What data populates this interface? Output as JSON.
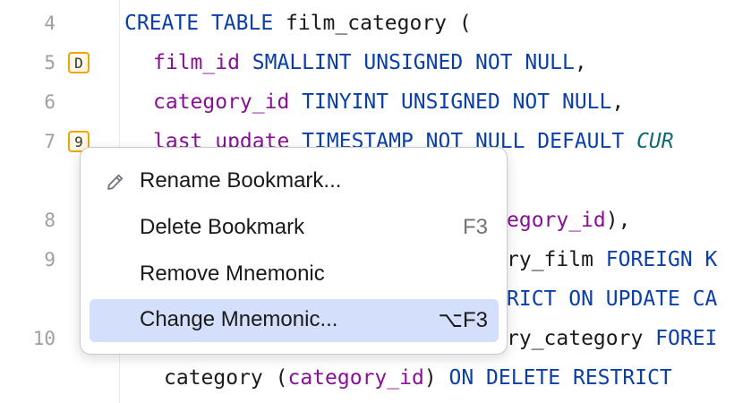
{
  "editor": {
    "line_numbers": [
      "4",
      "5",
      "6",
      "7",
      "8",
      "9",
      "10"
    ],
    "bookmarks": [
      {
        "line": "5",
        "mnemonic": "D"
      },
      {
        "line": "7",
        "mnemonic": "9"
      }
    ],
    "code": {
      "l1": {
        "kw1": "CREATE TABLE",
        "name": " film_category ("
      },
      "l2": {
        "id": "film_id",
        "type": " SMALLINT UNSIGNED NOT NULL",
        "punct": ","
      },
      "l3": {
        "id": "category_id",
        "type": " TINYINT UNSIGNED NOT NULL",
        "punct": ","
      },
      "l4": {
        "id": "last_update",
        "type": " TIMESTAMP NOT NULL DEFAULT ",
        "fn": "CUR"
      },
      "l5": {
        "id": "egory_id",
        "punct": "),"
      },
      "l6": {
        "plain": "ry_film ",
        "kw": "FOREIGN K"
      },
      "l7": {
        "kw": "RICT ON UPDATE CA"
      },
      "l8": {
        "plain": "ry_category ",
        "kw": "FOREI"
      },
      "l9": {
        "plain": "category (",
        "id": "category_id",
        "punct": ") ",
        "kw": "ON DELETE RESTRICT"
      }
    }
  },
  "context_menu": {
    "items": [
      {
        "label": "Rename Bookmark...",
        "shortcut": "",
        "icon": "pencil-icon"
      },
      {
        "label": "Delete Bookmark",
        "shortcut": "F3",
        "icon": ""
      },
      {
        "label": "Remove Mnemonic",
        "shortcut": "",
        "icon": ""
      },
      {
        "label": "Change Mnemonic...",
        "shortcut": "⌥F3",
        "icon": "",
        "selected": true
      }
    ]
  }
}
